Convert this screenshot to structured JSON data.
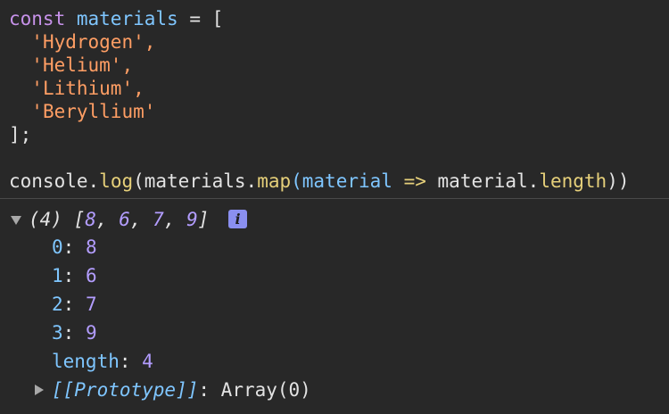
{
  "code": {
    "line1": {
      "kw": "const",
      "name": "materials",
      "op": "=",
      "open": "["
    },
    "items": [
      "'Hydrogen',",
      "'Helium',",
      "'Lithium',",
      "'Beryllium'"
    ],
    "close": "];",
    "call": {
      "obj": "console",
      "dot": ".",
      "method": "log",
      "open": "(materials.",
      "map": "map",
      "param": "(material",
      "arrow": "=>",
      "body": "material.",
      "prop": "length",
      "end": "))"
    }
  },
  "console": {
    "summary": {
      "count": "(4)",
      "open": "[",
      "values": [
        "8",
        "6",
        "7",
        "9"
      ],
      "close": "]"
    },
    "entries": [
      {
        "key": "0",
        "value": "8"
      },
      {
        "key": "1",
        "value": "6"
      },
      {
        "key": "2",
        "value": "7"
      },
      {
        "key": "3",
        "value": "9"
      }
    ],
    "length": {
      "key": "length",
      "value": "4"
    },
    "prototype": {
      "key": "[[Prototype]]",
      "value": "Array(0)"
    },
    "info_glyph": "i"
  },
  "colors": {
    "background": "#282828",
    "keyword": "#c792ea",
    "identifier": "#7fc6ff",
    "string": "#ff9e64",
    "function": "#e6d07a",
    "number": "#b39dff",
    "info_badge": "#8a8ff0"
  },
  "icons": {
    "expand": "triangle-down-icon",
    "collapse": "triangle-right-icon",
    "info": "info-icon"
  }
}
